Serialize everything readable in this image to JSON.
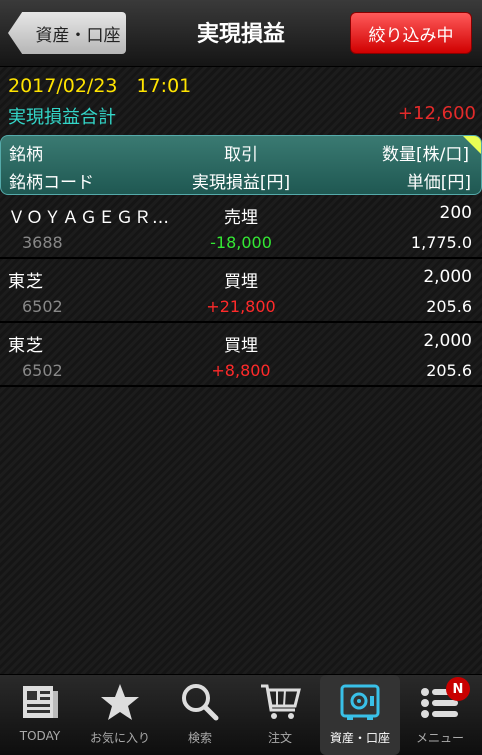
{
  "header": {
    "back_label": "資産・口座",
    "title": "実現損益",
    "filter_label": "絞り込み中"
  },
  "datetime": "2017/02/23　17:01",
  "summary": {
    "label": "実現損益合計",
    "value": "+12,600"
  },
  "columns": {
    "row1": [
      "銘柄",
      "取引",
      "数量[株/口]"
    ],
    "row2": [
      "銘柄コード",
      "実現損益[円]",
      "単価[円]"
    ]
  },
  "rows": [
    {
      "name": "ＶＯＹＡＧＥＧＲ…",
      "code": "3688",
      "trade": "売埋",
      "pl": "-18,000",
      "qty": "200",
      "price": "1,775.0"
    },
    {
      "name": "東芝",
      "code": "6502",
      "trade": "買埋",
      "pl": "+21,800",
      "qty": "2,000",
      "price": "205.6"
    },
    {
      "name": "東芝",
      "code": "6502",
      "trade": "買埋",
      "pl": "+8,800",
      "qty": "2,000",
      "price": "205.6"
    }
  ],
  "tabs": [
    {
      "label": "TODAY",
      "icon": "newspaper-icon"
    },
    {
      "label": "お気に入り",
      "icon": "star-icon"
    },
    {
      "label": "検索",
      "icon": "search-icon"
    },
    {
      "label": "注文",
      "icon": "cart-icon"
    },
    {
      "label": "資産・口座",
      "icon": "safe-icon"
    },
    {
      "label": "メニュー",
      "icon": "menu-icon"
    }
  ],
  "badge": "N",
  "colors": {
    "positive": "#ff2a2a",
    "negative": "#34e834",
    "accent": "#33d6c8",
    "date": "#ffe400"
  }
}
